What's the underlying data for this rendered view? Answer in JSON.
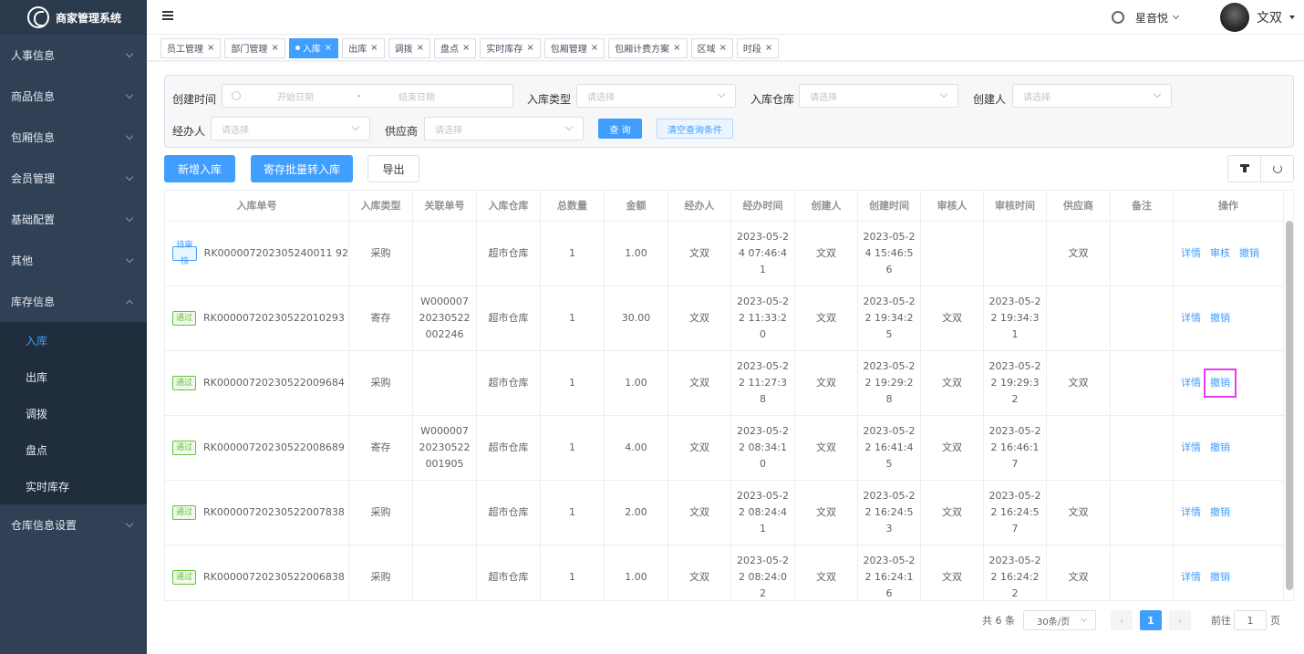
{
  "app": {
    "title": "商家管理系统"
  },
  "sidebar": {
    "menus": [
      {
        "label": "人事信息"
      },
      {
        "label": "商品信息"
      },
      {
        "label": "包厢信息"
      },
      {
        "label": "会员管理"
      },
      {
        "label": "基础配置"
      },
      {
        "label": "其他"
      },
      {
        "label": "库存信息"
      }
    ],
    "submenu": [
      "入库",
      "出库",
      "调拨",
      "盘点",
      "实时库存"
    ],
    "last_menu": "仓库信息设置"
  },
  "header": {
    "shop_name": "星音悦",
    "user_name": "文双"
  },
  "tabs": [
    "员工管理",
    "部门管理",
    "入库",
    "出库",
    "调拨",
    "盘点",
    "实时库存",
    "包厢管理",
    "包厢计费方案",
    "区域",
    "时段"
  ],
  "filter": {
    "created_time_label": "创建时间",
    "start_placeholder": "开始日期",
    "range_sep": "-",
    "end_placeholder": "结束日期",
    "type_label": "入库类型",
    "type_placeholder": "请选择",
    "warehouse_label": "入库仓库",
    "warehouse_placeholder": "请选择",
    "creator_label": "创建人",
    "creator_placeholder": "请选择",
    "handler_label": "经办人",
    "handler_placeholder": "请选择",
    "supplier_label": "供应商",
    "supplier_placeholder": "请选择",
    "query_label": "查 询",
    "clear_label": "清空查询条件"
  },
  "actions": {
    "new_label": "新增入库",
    "batch_label": "寄存批量转入库",
    "export_label": "导出"
  },
  "table": {
    "headers": [
      "入库单号",
      "入库类型",
      "关联单号",
      "入库仓库",
      "总数量",
      "金额",
      "经办人",
      "经办时间",
      "创建人",
      "创建时间",
      "审核人",
      "审核时间",
      "供应商",
      "备注",
      "操作"
    ],
    "rows": [
      {
        "status": "待审核",
        "no": "RK000007202305240011 92",
        "type": "采购",
        "rel": "",
        "wh": "超市仓库",
        "qty": "1",
        "amt": "1.00",
        "handler": "文双",
        "htime": "2023-05-2\n4 07:46:4\n1",
        "creator": "文双",
        "ctime": "2023-05-2\n4 15:46:5\n6",
        "auditor": "",
        "atime": "",
        "supplier": "文双",
        "remark": "",
        "ops": [
          "详情",
          "审核",
          "撤销"
        ]
      },
      {
        "status": "通过",
        "no": "RK00000720230522010293",
        "type": "寄存",
        "rel": "W000007\n20230522\n002246",
        "wh": "超市仓库",
        "qty": "1",
        "amt": "30.00",
        "handler": "文双",
        "htime": "2023-05-2\n2 11:33:2\n0",
        "creator": "文双",
        "ctime": "2023-05-2\n2 19:34:2\n5",
        "auditor": "文双",
        "atime": "2023-05-2\n2 19:34:3\n1",
        "supplier": "",
        "remark": "",
        "ops": [
          "详情",
          "撤销"
        ]
      },
      {
        "status": "通过",
        "no": "RK00000720230522009684",
        "type": "采购",
        "rel": "",
        "wh": "超市仓库",
        "qty": "1",
        "amt": "1.00",
        "handler": "文双",
        "htime": "2023-05-2\n2 11:27:3\n8",
        "creator": "文双",
        "ctime": "2023-05-2\n2 19:29:2\n8",
        "auditor": "文双",
        "atime": "2023-05-2\n2 19:29:3\n2",
        "supplier": "文双",
        "remark": "",
        "ops": [
          "详情",
          "撤销"
        ]
      },
      {
        "status": "通过",
        "no": "RK00000720230522008689",
        "type": "寄存",
        "rel": "W000007\n20230522\n001905",
        "wh": "超市仓库",
        "qty": "1",
        "amt": "4.00",
        "handler": "文双",
        "htime": "2023-05-2\n2 08:34:1\n0",
        "creator": "文双",
        "ctime": "2023-05-2\n2 16:41:4\n5",
        "auditor": "文双",
        "atime": "2023-05-2\n2 16:46:1\n7",
        "supplier": "",
        "remark": "",
        "ops": [
          "详情",
          "撤销"
        ]
      },
      {
        "status": "通过",
        "no": "RK00000720230522007838",
        "type": "采购",
        "rel": "",
        "wh": "超市仓库",
        "qty": "1",
        "amt": "2.00",
        "handler": "文双",
        "htime": "2023-05-2\n2 08:24:4\n1",
        "creator": "文双",
        "ctime": "2023-05-2\n2 16:24:5\n3",
        "auditor": "文双",
        "atime": "2023-05-2\n2 16:24:5\n7",
        "supplier": "文双",
        "remark": "",
        "ops": [
          "详情",
          "撤销"
        ]
      },
      {
        "status": "通过",
        "no": "RK00000720230522006838",
        "type": "采购",
        "rel": "",
        "wh": "超市仓库",
        "qty": "1",
        "amt": "1.00",
        "handler": "文双",
        "htime": "2023-05-2\n2 08:24:0\n2",
        "creator": "文双",
        "ctime": "2023-05-2\n2 16:24:1\n6",
        "auditor": "文双",
        "atime": "2023-05-2\n2 16:24:2\n2",
        "supplier": "文双",
        "remark": "",
        "ops": [
          "详情",
          "撤销"
        ]
      }
    ]
  },
  "pagination": {
    "total": "共 6 条",
    "page_size": "30条/页",
    "current": "1",
    "goto_prefix": "前往",
    "goto_value": "1",
    "goto_suffix": "页"
  }
}
